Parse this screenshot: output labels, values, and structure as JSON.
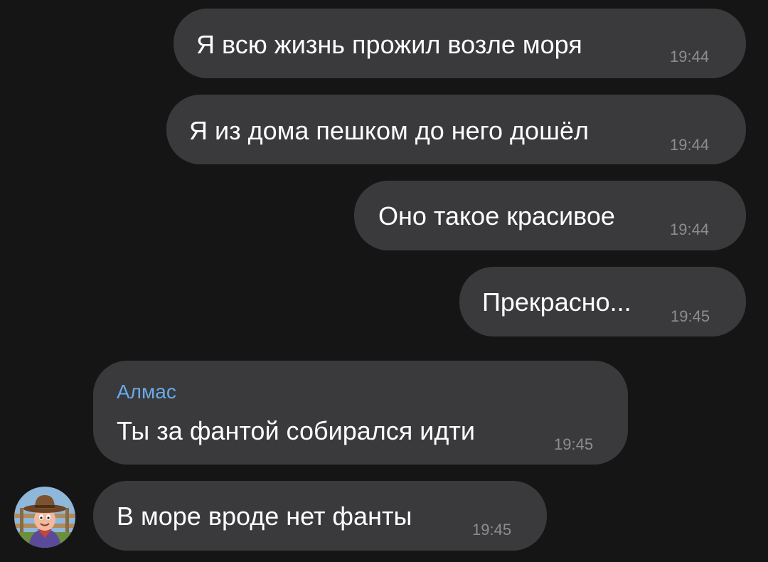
{
  "messages": [
    {
      "text": "Я всю жизнь прожил возле моря",
      "time": "19:44"
    },
    {
      "text": "Я из дома пешком до него дошёл",
      "time": "19:44"
    },
    {
      "text": "Оно такое красивое",
      "time": "19:44"
    },
    {
      "text": "Прекрасно...",
      "time": "19:45"
    },
    {
      "sender": "Алмас",
      "text": "Ты за фантой собирался идти",
      "time": "19:45"
    },
    {
      "text": "В море вроде нет фанты",
      "time": "19:45"
    }
  ],
  "avatar": {
    "icon": "cartoon-cowboy-avatar"
  },
  "colors": {
    "background": "#151515",
    "bubble": "#3a3a3c",
    "text": "#ffffff",
    "time": "#8d8d90",
    "sender": "#6aa9e8"
  }
}
